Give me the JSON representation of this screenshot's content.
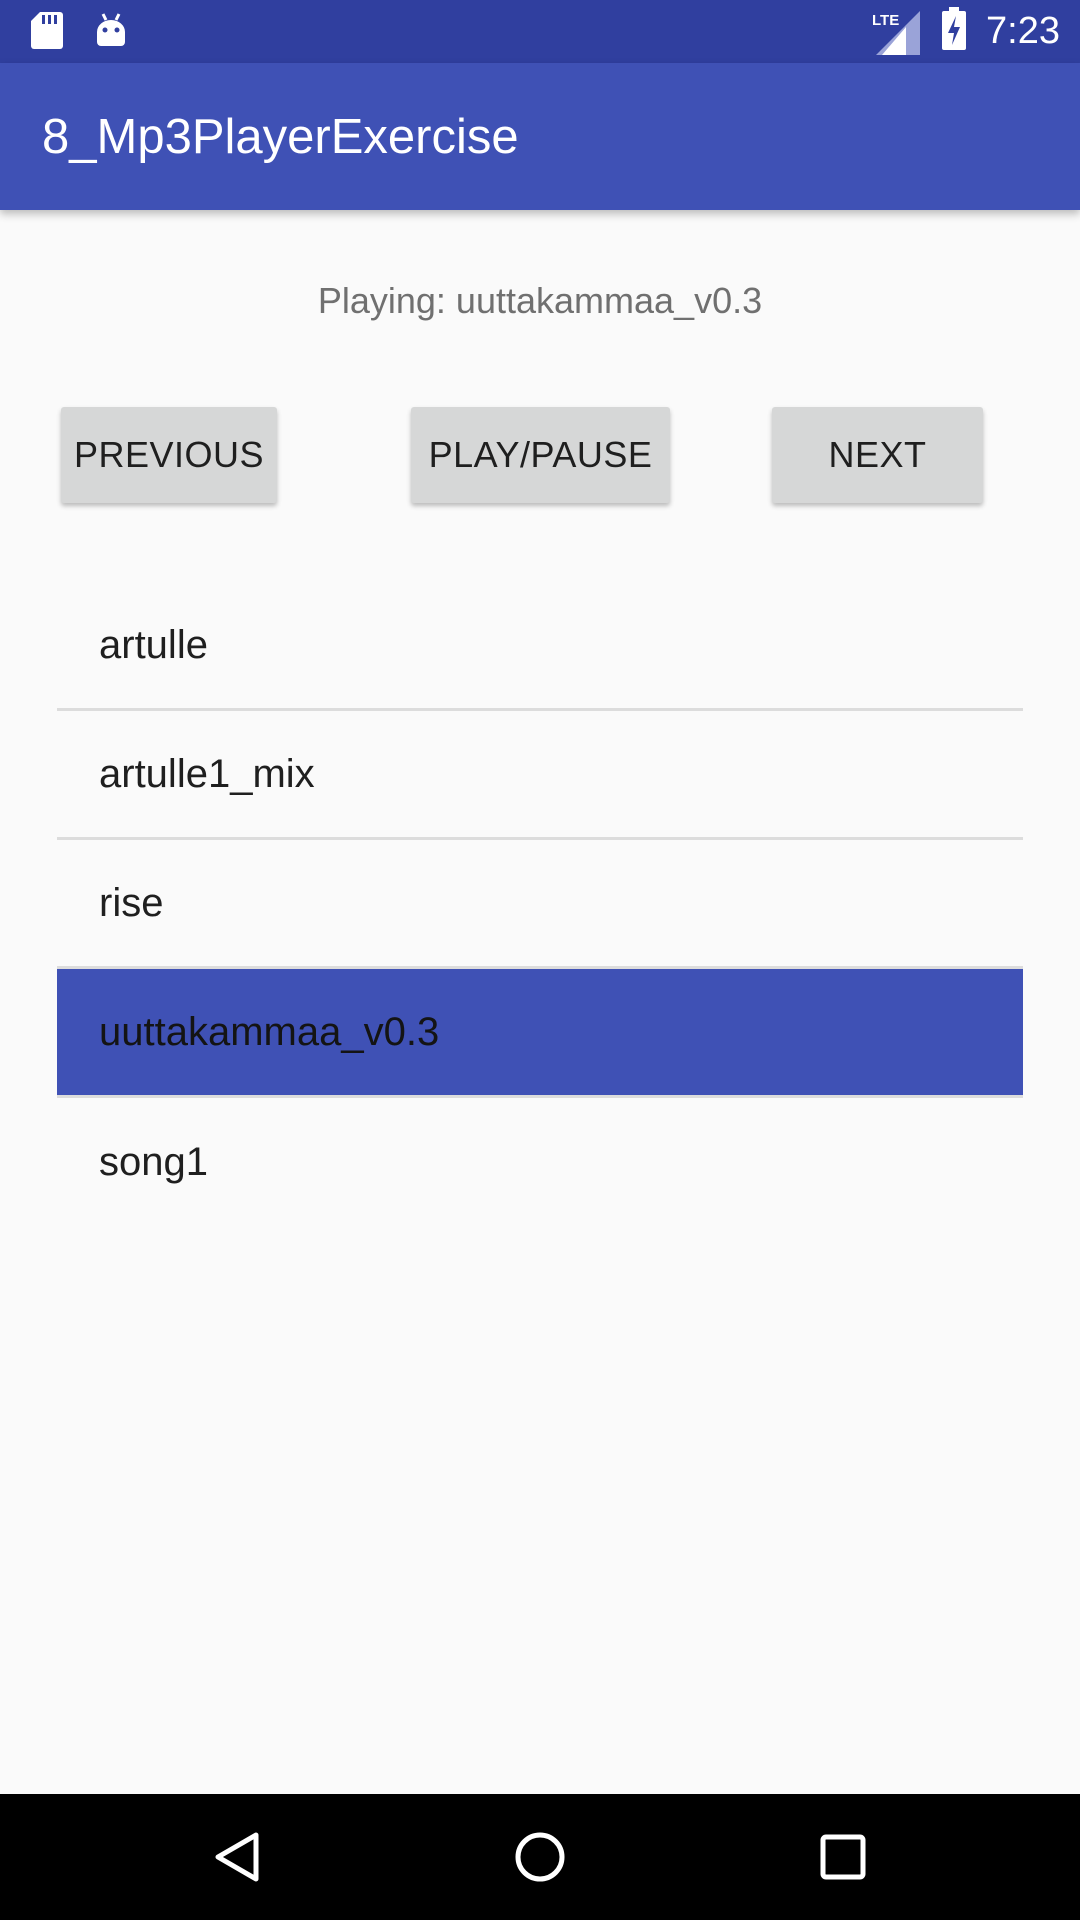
{
  "status_bar": {
    "time": "7:23",
    "network_label": "LTE",
    "icons": [
      "sd-card-icon",
      "android-icon",
      "signal-icon",
      "battery-charging-icon"
    ]
  },
  "app_bar": {
    "title": "8_Mp3PlayerExercise"
  },
  "now_playing": {
    "text": "Playing: uuttakammaa_v0.3"
  },
  "controls": {
    "previous_label": "PREVIOUS",
    "play_pause_label": "PLAY/PAUSE",
    "next_label": "NEXT"
  },
  "songs": [
    {
      "title": "artulle"
    },
    {
      "title": "artulle1_mix"
    },
    {
      "title": "rise"
    },
    {
      "title": "uuttakammaa_v0.3",
      "selected": true
    },
    {
      "title": "song1"
    }
  ],
  "nav_bar": {
    "icons": [
      "back-icon",
      "home-icon",
      "recent-apps-icon"
    ]
  },
  "colors": {
    "status_bar": "#303f9f",
    "app_bar": "#3f51b5",
    "selected_item": "#3f51b5",
    "button": "#d6d7d7"
  }
}
